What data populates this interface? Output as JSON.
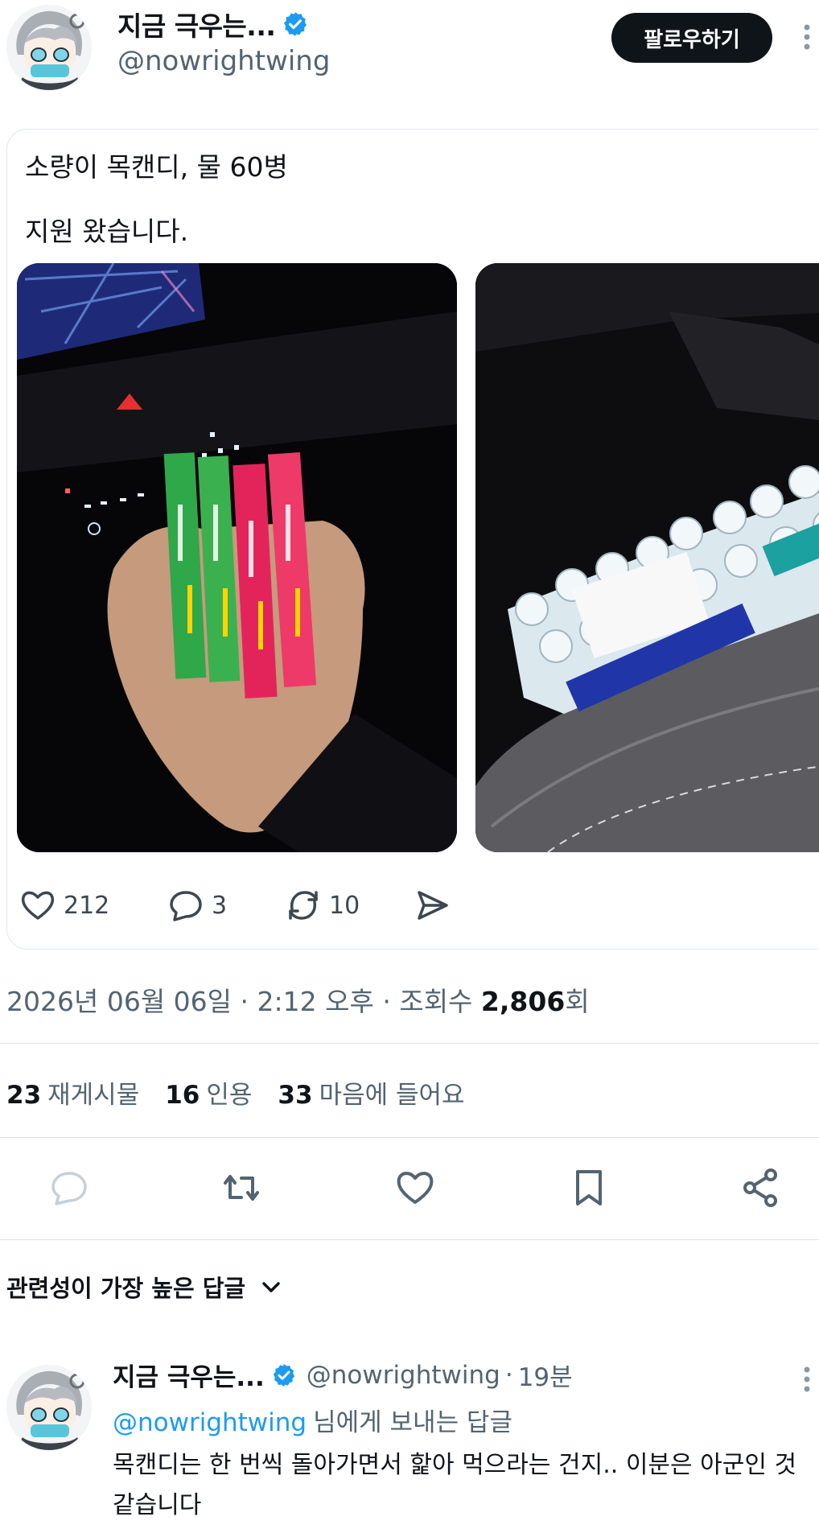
{
  "author": {
    "display_name": "지금 극우는...",
    "handle": "@nowrightwing",
    "verified": true,
    "follow_label": "팔로우하기"
  },
  "quoted_post": {
    "text_line1": "소량이 목캔디, 물 60병",
    "text_line2": "지원 왔습니다.",
    "media": [
      {
        "description_icon": "photo-hand-holding-candy-boxes"
      },
      {
        "description_icon": "photo-water-bottles-in-car"
      }
    ],
    "stats": {
      "likes": "212",
      "replies": "3",
      "reposts": "10"
    }
  },
  "meta": {
    "date": "2026년 06월 06일",
    "time": "2:12 오후",
    "views_label": "조회수",
    "views": "2,806",
    "views_suffix": "회",
    "separator": "·"
  },
  "counts": {
    "reposts_num": "23",
    "reposts_label": "재게시물",
    "quotes_num": "16",
    "quotes_label": "인용",
    "likes_num": "33",
    "likes_label": "마음에 들어요"
  },
  "actions": [
    "reply-icon",
    "repost-icon",
    "like-icon",
    "bookmark-icon",
    "share-icon"
  ],
  "replies_sort": {
    "label": "관련성이 가장 높은 답글"
  },
  "reply": {
    "display_name": "지금 극우는...",
    "handle": "@nowrightwing",
    "time": "19분",
    "replying_to_mention": "@nowrightwing",
    "replying_to_suffix": "님에게 보내는 답글",
    "text": "목캔디는 한 번씩 돌아가면서 핥아 먹으라는 건지.. 이분은 아군인 것 같습니다"
  },
  "colors": {
    "accent": "#1d9bf0",
    "text": "#0f1419",
    "secondary": "#536471",
    "follow_bg": "#0f1419"
  }
}
